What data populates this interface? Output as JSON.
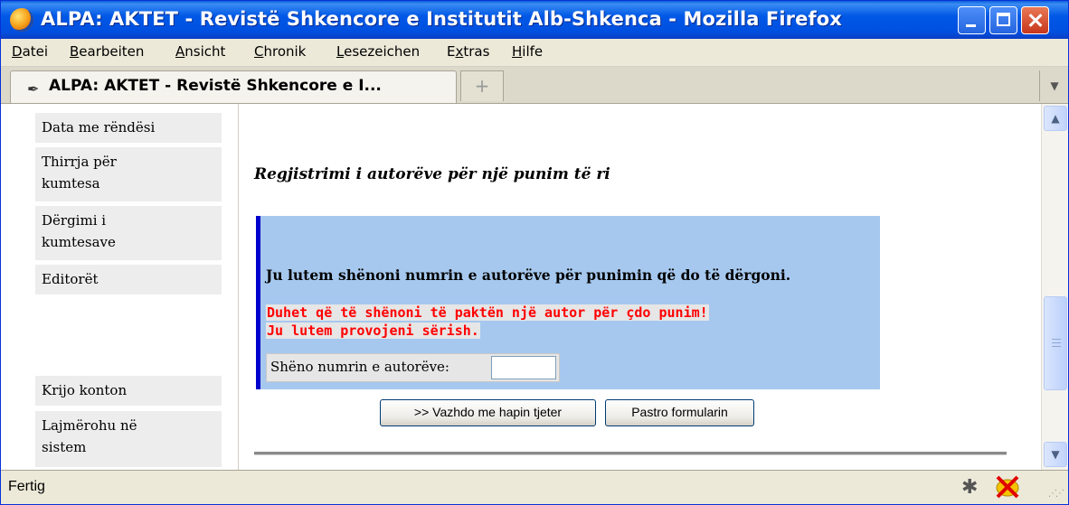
{
  "window": {
    "title": "ALPA: AKTET - Revistë Shkencore e Institutit Alb-Shkenca - Mozilla Firefox"
  },
  "menu": [
    {
      "pre": "",
      "ul": "D",
      "post": "atei"
    },
    {
      "pre": "",
      "ul": "B",
      "post": "earbeiten"
    },
    {
      "pre": "",
      "ul": "A",
      "post": "nsicht"
    },
    {
      "pre": "",
      "ul": "C",
      "post": "hronik"
    },
    {
      "pre": "",
      "ul": "L",
      "post": "esezeichen"
    },
    {
      "pre": "E",
      "ul": "x",
      "post": "tras"
    },
    {
      "pre": "",
      "ul": "H",
      "post": "ilfe"
    }
  ],
  "tab": {
    "title": "ALPA: AKTET - Revistë Shkencore e I...",
    "new_tab_symbol": "+"
  },
  "sidebar": {
    "items": [
      {
        "line1": "Data me rëndësi",
        "line2": ""
      },
      {
        "line1": "Thirrja për",
        "line2": "kumtesa"
      },
      {
        "line1": "Dërgimi i",
        "line2": "kumtesave"
      },
      {
        "line1": "Editorët",
        "line2": ""
      },
      {
        "line1": "Krijo konton",
        "line2": ""
      },
      {
        "line1": "Lajmërohu në",
        "line2": "sistem"
      }
    ]
  },
  "main": {
    "heading": "Regjistrimi i autorëve për një punim të ri",
    "prompt": "Ju lutem shënoni numrin e autorëve për punimin që do të dërgoni.",
    "error_line1": "Duhet që të shënoni të paktën një autor për çdo punim!",
    "error_line2": "Ju lutem provojeni sërish.",
    "field_label": "Shëno numrin e autorëve:",
    "field_value": "",
    "continue_button": ">> Vazhdo me hapin tjeter",
    "clear_button": "Pastro formularin"
  },
  "status": {
    "text": "Fertig"
  },
  "colors": {
    "titlebar": "#0058E6",
    "panel": "#A6C8EE",
    "panel_border": "#0000CC",
    "error": "#FF0000"
  }
}
